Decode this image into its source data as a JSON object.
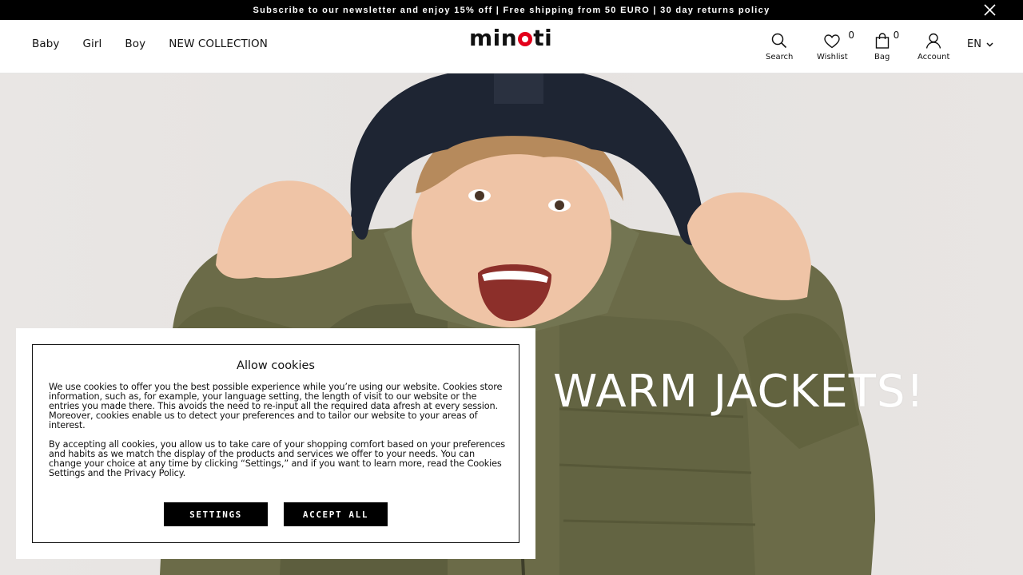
{
  "promo": {
    "text": "Subscribe to our newsletter and enjoy 15% off | Free shipping from 50 EURO | 30 day returns policy",
    "close_icon": "close-icon"
  },
  "header": {
    "nav": [
      {
        "label": "Baby"
      },
      {
        "label": "Girl"
      },
      {
        "label": "Boy"
      },
      {
        "label": "NEW COLLECTION"
      }
    ],
    "logo": {
      "pre": "min",
      "post": "ti",
      "accent": "#e3001b"
    },
    "utilities": {
      "search": {
        "label": "Search",
        "icon": "search-icon"
      },
      "wishlist": {
        "label": "Wishlist",
        "count": "0",
        "icon": "heart-icon"
      },
      "bag": {
        "label": "Bag",
        "count": "0",
        "icon": "bag-icon"
      },
      "account": {
        "label": "Account",
        "icon": "user-icon"
      }
    },
    "language": "EN"
  },
  "hero": {
    "title_visible": "F WARM JACKETS!"
  },
  "cookies": {
    "title": "Allow cookies",
    "paragraph1": "We use cookies to offer you the best possible experience while you’re using our website. Cookies store information, such as, for example, your language setting, the length of visit to our website or the entries you made there. This avoids the need to re-input all the required data afresh at every session. Moreover, cookies enable us to detect your preferences and to tailor our website to your areas of interest.",
    "paragraph2": "By accepting all cookies, you allow us to take care of your shopping comfort based on your preferences and habits as we match the display of the products and services we offer to your needs. You can change your choice at any time by clicking “Settings,” and if you want to learn more, read the Cookies Settings and the Privacy Policy.",
    "settings_label": "SETTINGS",
    "accept_label": "ACCEPT ALL"
  }
}
